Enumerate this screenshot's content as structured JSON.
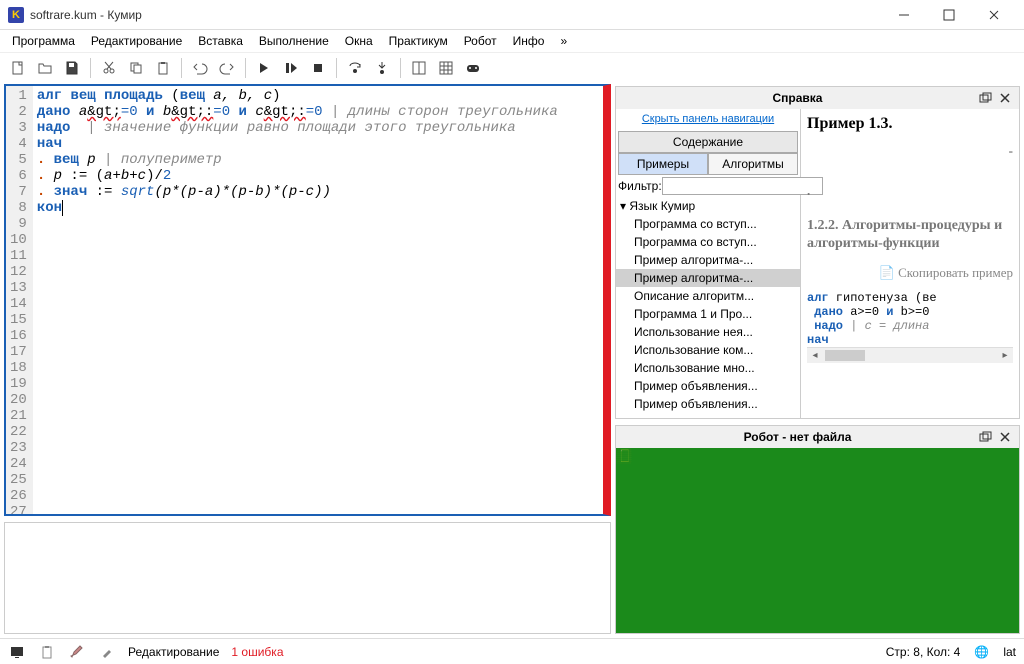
{
  "window": {
    "title": "softrare.kum - Кумир"
  },
  "menu": [
    "Программа",
    "Редактирование",
    "Вставка",
    "Выполнение",
    "Окна",
    "Практикум",
    "Робот",
    "Инфо",
    "»"
  ],
  "editor": {
    "line_numbers": [
      1,
      2,
      3,
      4,
      5,
      6,
      7,
      8,
      9,
      10,
      11,
      12,
      13,
      14,
      15,
      16,
      17,
      18,
      19,
      20,
      21,
      22,
      23,
      24,
      25,
      26,
      27
    ]
  },
  "code": {
    "l1_alg": "алг",
    "l1_type": "вещ",
    "l1_name": "площадь",
    "l1_par_open": " (",
    "l1_par_type": "вещ",
    "l1_vars": " a, b, c",
    "l1_par_close": ")",
    "l2_dano": "дано",
    "l2_a": " a",
    "l2_gt1": "&gt;",
    "l2_eq0a": "=0",
    "l2_and1": " и ",
    "l2_b": "b",
    "l2_gt2": "&gt;:",
    "l2_eq0b": "=0",
    "l2_and2": " и ",
    "l2_c": "c",
    "l2_gt3": "&gt;:",
    "l2_eq0c": "=0",
    "l2_cm": " | длины сторон треугольника",
    "l3_nado": "надо",
    "l3_cm": "  | значение функции равно площади этого треугольника",
    "l4": "нач",
    "l5_dot": ". ",
    "l5_type": "вещ",
    "l5_var": " p",
    "l5_cm": " | полупериметр",
    "l6_dot": ". ",
    "l6_p": "p",
    "l6_assign": " := (",
    "l6_abc": "a+b+c",
    "l6_div": ")/",
    "l6_two": "2",
    "l7_dot": ". ",
    "l7_znach": "знач",
    "l7_assign": " := ",
    "l7_sqrt": "sqrt",
    "l7_expr": "(p*(p-a)*(p-b)*(p-c))",
    "l8": "кон"
  },
  "help": {
    "panel_title": "Справка",
    "hide_nav": "Скрыть панель навигации",
    "tab_content": "Содержание",
    "tab_examples": "Примеры",
    "tab_algos": "Алгоритмы",
    "filter_label": "Фильтр:",
    "tree_root": "Язык Кумир",
    "tree": [
      "Программа со вступ...",
      "Программа со вступ...",
      "Пример алгоритма-...",
      "Пример алгоритма-...",
      "Описание алгоритм...",
      "Программа 1 и Про...",
      "Использование нея...",
      "Использование ком...",
      "Использование мно...",
      "Пример объявления...",
      "Пример объявления..."
    ],
    "doc_title": "Пример 1.3.",
    "dash": "-",
    "section_dot": ".",
    "section": "1.2.2. Алгоритмы-процедуры и алгоритмы-функции",
    "copy": "Скопировать пример",
    "sample_l1_alg": "алг",
    "sample_l1_rest": " гипотенуза (ве",
    "sample_l2_dano": "дано",
    "sample_l2a": " a>=0 ",
    "sample_l2_and": "и",
    "sample_l2b": " b>=0",
    "sample_l3_nado": "надо",
    "sample_l3_cm": " | c = длина",
    "sample_l4": "нач"
  },
  "robot": {
    "panel_title": "Робот - нет файла"
  },
  "status": {
    "mode": "Редактирование",
    "errors": "1 ошибка",
    "pos": "Стр: 8, Кол: 4",
    "kb": "lat"
  }
}
